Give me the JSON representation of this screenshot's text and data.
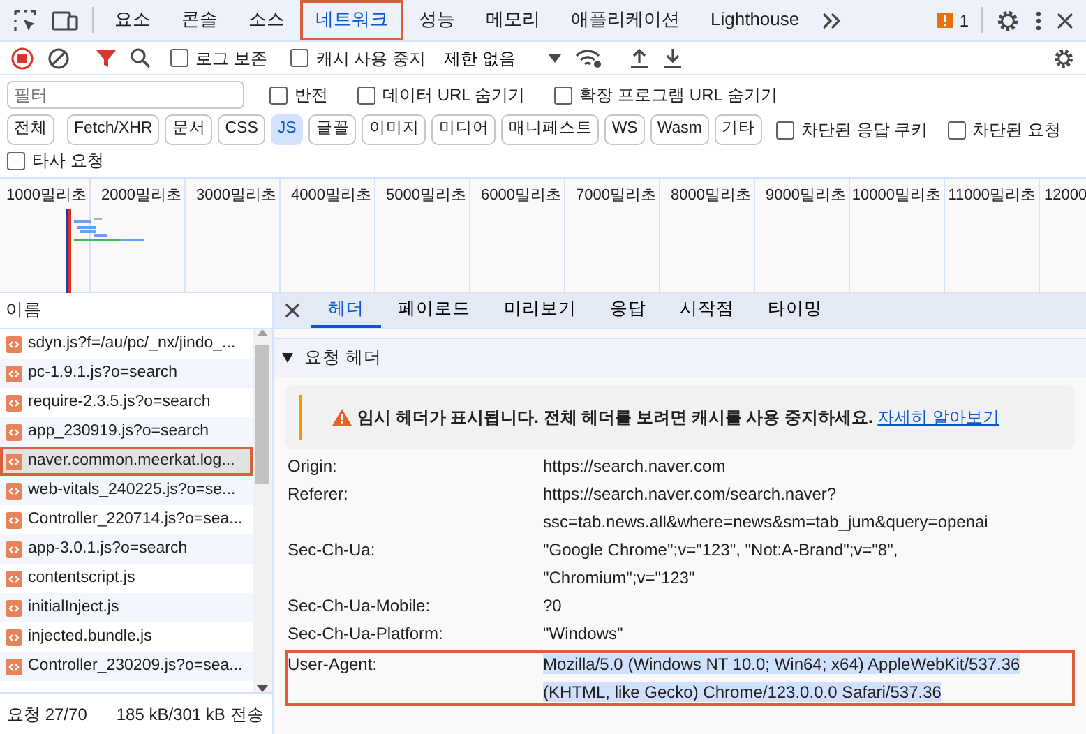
{
  "panel_tabs": [
    {
      "label": "요소",
      "selected": false,
      "highlighted": false
    },
    {
      "label": "콘솔",
      "selected": false,
      "highlighted": false
    },
    {
      "label": "소스",
      "selected": false,
      "highlighted": false
    },
    {
      "label": "네트워크",
      "selected": true,
      "highlighted": true
    },
    {
      "label": "성능",
      "selected": false,
      "highlighted": false
    },
    {
      "label": "메모리",
      "selected": false,
      "highlighted": false
    },
    {
      "label": "애플리케이션",
      "selected": false,
      "highlighted": false
    },
    {
      "label": "Lighthouse",
      "selected": false,
      "highlighted": false
    }
  ],
  "issues_count": "1",
  "toolbar": {
    "checkboxes": [
      {
        "label": "로그 보존",
        "checked": false
      },
      {
        "label": "캐시 사용 중지",
        "checked": false
      }
    ],
    "throttling": "제한 없음"
  },
  "filter": {
    "placeholder": "필터",
    "checkboxes": [
      {
        "label": "반전",
        "checked": false
      },
      {
        "label": "데이터 URL 숨기기",
        "checked": false
      },
      {
        "label": "확장 프로그램 URL 숨기기",
        "checked": false
      }
    ]
  },
  "type_filters": [
    {
      "label": "전체",
      "selected": false
    },
    {
      "label": "Fetch/XHR",
      "selected": false
    },
    {
      "label": "문서",
      "selected": false
    },
    {
      "label": "CSS",
      "selected": false
    },
    {
      "label": "JS",
      "selected": true
    },
    {
      "label": "글꼴",
      "selected": false
    },
    {
      "label": "이미지",
      "selected": false
    },
    {
      "label": "미디어",
      "selected": false
    },
    {
      "label": "매니페스트",
      "selected": false
    },
    {
      "label": "WS",
      "selected": false
    },
    {
      "label": "Wasm",
      "selected": false
    },
    {
      "label": "기타",
      "selected": false
    }
  ],
  "extra_checkboxes": [
    {
      "label": "차단된 응답 쿠키",
      "checked": false
    },
    {
      "label": "차단된 요청",
      "checked": false
    },
    {
      "label": "타사 요청",
      "checked": false
    }
  ],
  "overview": {
    "ticks": [
      "1000밀리초",
      "2000밀리초",
      "3000밀리초",
      "4000밀리초",
      "5000밀리초",
      "6000밀리초",
      "7000밀리초",
      "8000밀리초",
      "9000밀리초",
      "10000밀리초",
      "11000밀리초",
      "12000"
    ]
  },
  "requests": {
    "column": "이름",
    "rows": [
      {
        "name": "sdyn.js?f=/au/pc/_nx/jindo_...",
        "selected": false,
        "highlighted": false
      },
      {
        "name": "pc-1.9.1.js?o=search",
        "selected": false,
        "highlighted": false
      },
      {
        "name": "require-2.3.5.js?o=search",
        "selected": false,
        "highlighted": false
      },
      {
        "name": "app_230919.js?o=search",
        "selected": false,
        "highlighted": false
      },
      {
        "name": "naver.common.meerkat.log...",
        "selected": true,
        "highlighted": true
      },
      {
        "name": "web-vitals_240225.js?o=se...",
        "selected": false,
        "highlighted": false
      },
      {
        "name": "Controller_220714.js?o=sea...",
        "selected": false,
        "highlighted": false
      },
      {
        "name": "app-3.0.1.js?o=search",
        "selected": false,
        "highlighted": false
      },
      {
        "name": "contentscript.js",
        "selected": false,
        "highlighted": false
      },
      {
        "name": "initialInject.js",
        "selected": false,
        "highlighted": false
      },
      {
        "name": "injected.bundle.js",
        "selected": false,
        "highlighted": false
      },
      {
        "name": "Controller_230209.js?o=sea...",
        "selected": false,
        "highlighted": false
      }
    ]
  },
  "status_bar": {
    "requests": "요청 27/70",
    "transferred": "185 kB/301 kB 전송"
  },
  "details": {
    "tabs": [
      {
        "label": "헤더",
        "selected": true
      },
      {
        "label": "페이로드",
        "selected": false
      },
      {
        "label": "미리보기",
        "selected": false
      },
      {
        "label": "응답",
        "selected": false
      },
      {
        "label": "시작점",
        "selected": false
      },
      {
        "label": "타이밍",
        "selected": false
      }
    ],
    "section": {
      "title": "요청 헤더",
      "expanded": true
    },
    "warning": {
      "text": "임시 헤더가 표시됩니다. 전체 헤더를 보려면 캐시를 사용 중지하세요.",
      "link": "자세히 알아보기"
    },
    "headers": [
      {
        "name": "Origin:",
        "lines": [
          "https://search.naver.com"
        ],
        "text_selected": false,
        "highlighted": false
      },
      {
        "name": "Referer:",
        "lines": [
          "https://search.naver.com/search.naver?",
          "ssc=tab.news.all&where=news&sm=tab_jum&query=openai"
        ],
        "text_selected": false,
        "highlighted": false
      },
      {
        "name": "Sec-Ch-Ua:",
        "lines": [
          "\"Google Chrome\";v=\"123\", \"Not:A-Brand\";v=\"8\",",
          "\"Chromium\";v=\"123\""
        ],
        "text_selected": false,
        "highlighted": false
      },
      {
        "name": "Sec-Ch-Ua-Mobile:",
        "lines": [
          "?0"
        ],
        "text_selected": false,
        "highlighted": false
      },
      {
        "name": "Sec-Ch-Ua-Platform:",
        "lines": [
          "\"Windows\""
        ],
        "text_selected": false,
        "highlighted": false
      },
      {
        "name": "User-Agent:",
        "lines": [
          "Mozilla/5.0 (Windows NT 10.0; Win64; x64) AppleWebKit/537.36",
          "(KHTML, like Gecko) Chrome/123.0.0.0 Safari/537.36"
        ],
        "text_selected": true,
        "highlighted": true
      }
    ]
  }
}
